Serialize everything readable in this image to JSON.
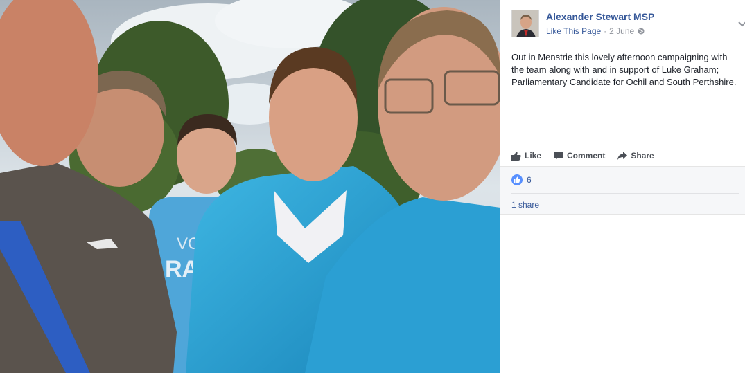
{
  "post": {
    "page_name": "Alexander Stewart MSP",
    "like_page_label": "Like This Page",
    "separator": "·",
    "date": "2 June",
    "visibility_icon": "globe-icon",
    "menu_icon": "chevron-down-icon",
    "text": "Out in Menstrie this lovely afternoon campaigning with the team along with and in support of Luke Graham; Parliamentary Candidate for Ochil and South Perthshire."
  },
  "actions": {
    "like_label": "Like",
    "comment_label": "Comment",
    "share_label": "Share"
  },
  "engagement": {
    "reaction_count": "6",
    "shares_label": "1 share"
  },
  "photo": {
    "shirt_text_line1": "VOT",
    "shirt_text_line2": "RAH"
  },
  "colors": {
    "link_blue": "#365899",
    "meta_gray": "#90949c",
    "text_dark": "#1d2129",
    "like_blue": "#5890ff",
    "jacket_blue": "#2a9fd0"
  }
}
